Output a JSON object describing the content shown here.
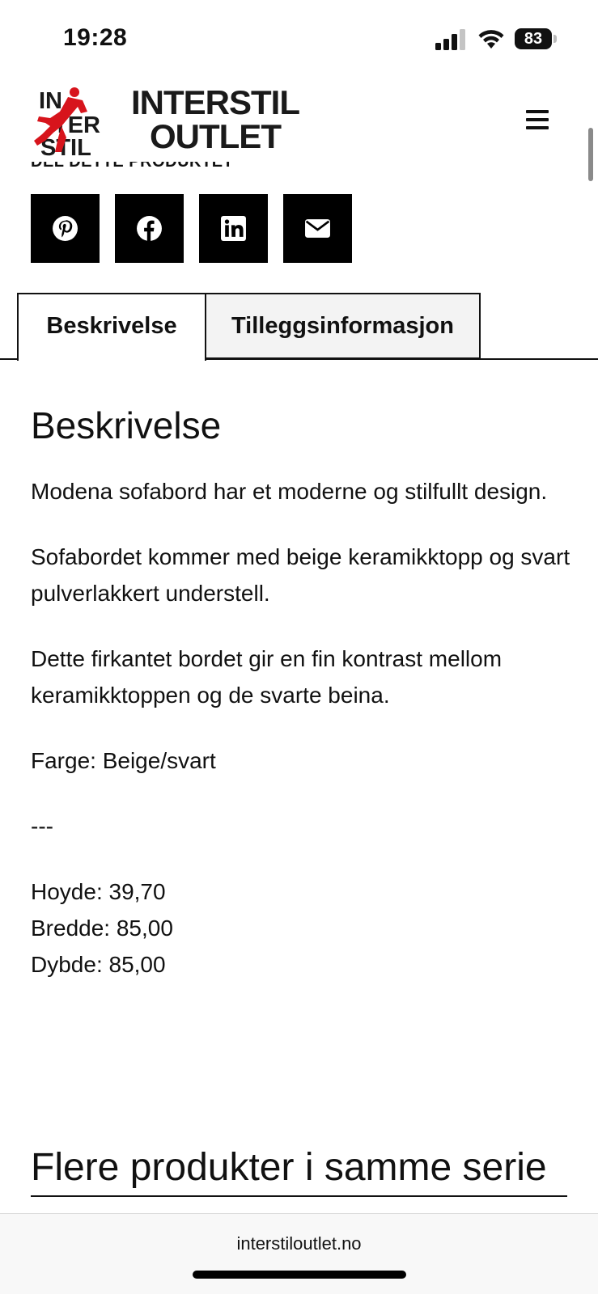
{
  "status_bar": {
    "time": "19:28",
    "battery": "83",
    "icons": [
      "signal-icon",
      "wifi-icon",
      "battery-icon"
    ]
  },
  "header": {
    "logo_mark_line1": "IN",
    "logo_mark_line2": "TER",
    "logo_mark_line3": "STIL",
    "logo_line1": "INTERSTIL",
    "logo_line2": "OUTLET",
    "menu_icon": "hamburger-menu-icon",
    "brand_red": "#d7141c"
  },
  "share": {
    "label": "DEL DETTE PRODUKTET",
    "buttons": [
      {
        "icon": "pinterest-icon"
      },
      {
        "icon": "facebook-icon"
      },
      {
        "icon": "linkedin-icon"
      },
      {
        "icon": "email-icon"
      }
    ]
  },
  "tabs": [
    {
      "label": "Beskrivelse",
      "active": true
    },
    {
      "label": "Tilleggsinformasjon",
      "active": false
    }
  ],
  "description": {
    "heading": "Beskrivelse",
    "paragraphs": [
      "Modena sofabord har et moderne og stilfullt design.",
      "Sofabordet kommer med beige keramikktopp og svart pulverlakkert understell.",
      "Dette firkantet bordet gir en fin kontrast mellom keramikktoppen og de svarte beina.",
      "Farge: Beige/svart",
      "---"
    ],
    "dimensions": [
      "Hoyde: 39,70",
      "Bredde: 85,00",
      "Dybde: 85,00"
    ]
  },
  "more_products": {
    "heading": "Flere produkter i samme serie"
  },
  "browser": {
    "url": "interstiloutlet.no"
  }
}
